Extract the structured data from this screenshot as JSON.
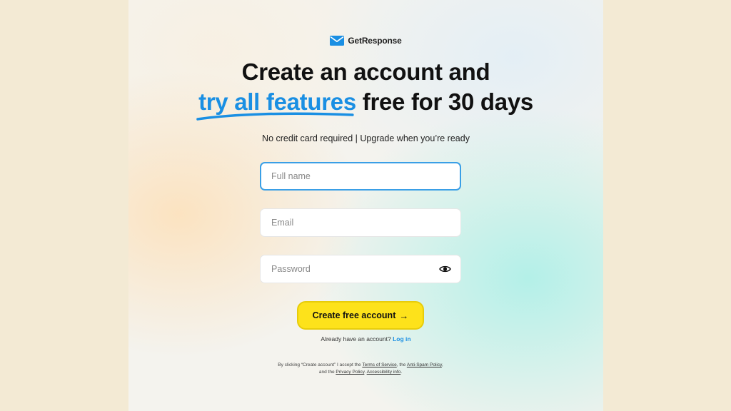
{
  "brand": {
    "name": "GetResponse",
    "icon": "envelope-icon",
    "color": "#1a8fe3"
  },
  "headline": {
    "line1": "Create an account and",
    "highlight": "try all features",
    "line2_rest": "free for 30 days"
  },
  "subtitle": "No credit card required | Upgrade when you’re ready",
  "form": {
    "full_name": {
      "placeholder": "Full name",
      "value": ""
    },
    "email": {
      "placeholder": "Email",
      "value": ""
    },
    "password": {
      "placeholder": "Password",
      "value": "",
      "toggle_icon": "eye-icon"
    }
  },
  "cta": {
    "label": "Create free account",
    "arrow": "→",
    "color": "#fde21b"
  },
  "login": {
    "prompt": "Already have an account?",
    "link": "Log in"
  },
  "legal": {
    "prefix": "By clicking “Create account” I accept the",
    "terms": "Terms of Service",
    "sep1": ", the",
    "antispam": "Anti-Spam Policy",
    "sep2": ", and the",
    "privacy": "Privacy Policy",
    "sep3": ".",
    "accessibility": "Accessibility info",
    "end": "."
  },
  "colors": {
    "side_background": "#f3ead4",
    "focus_border": "#3a9fe6"
  }
}
